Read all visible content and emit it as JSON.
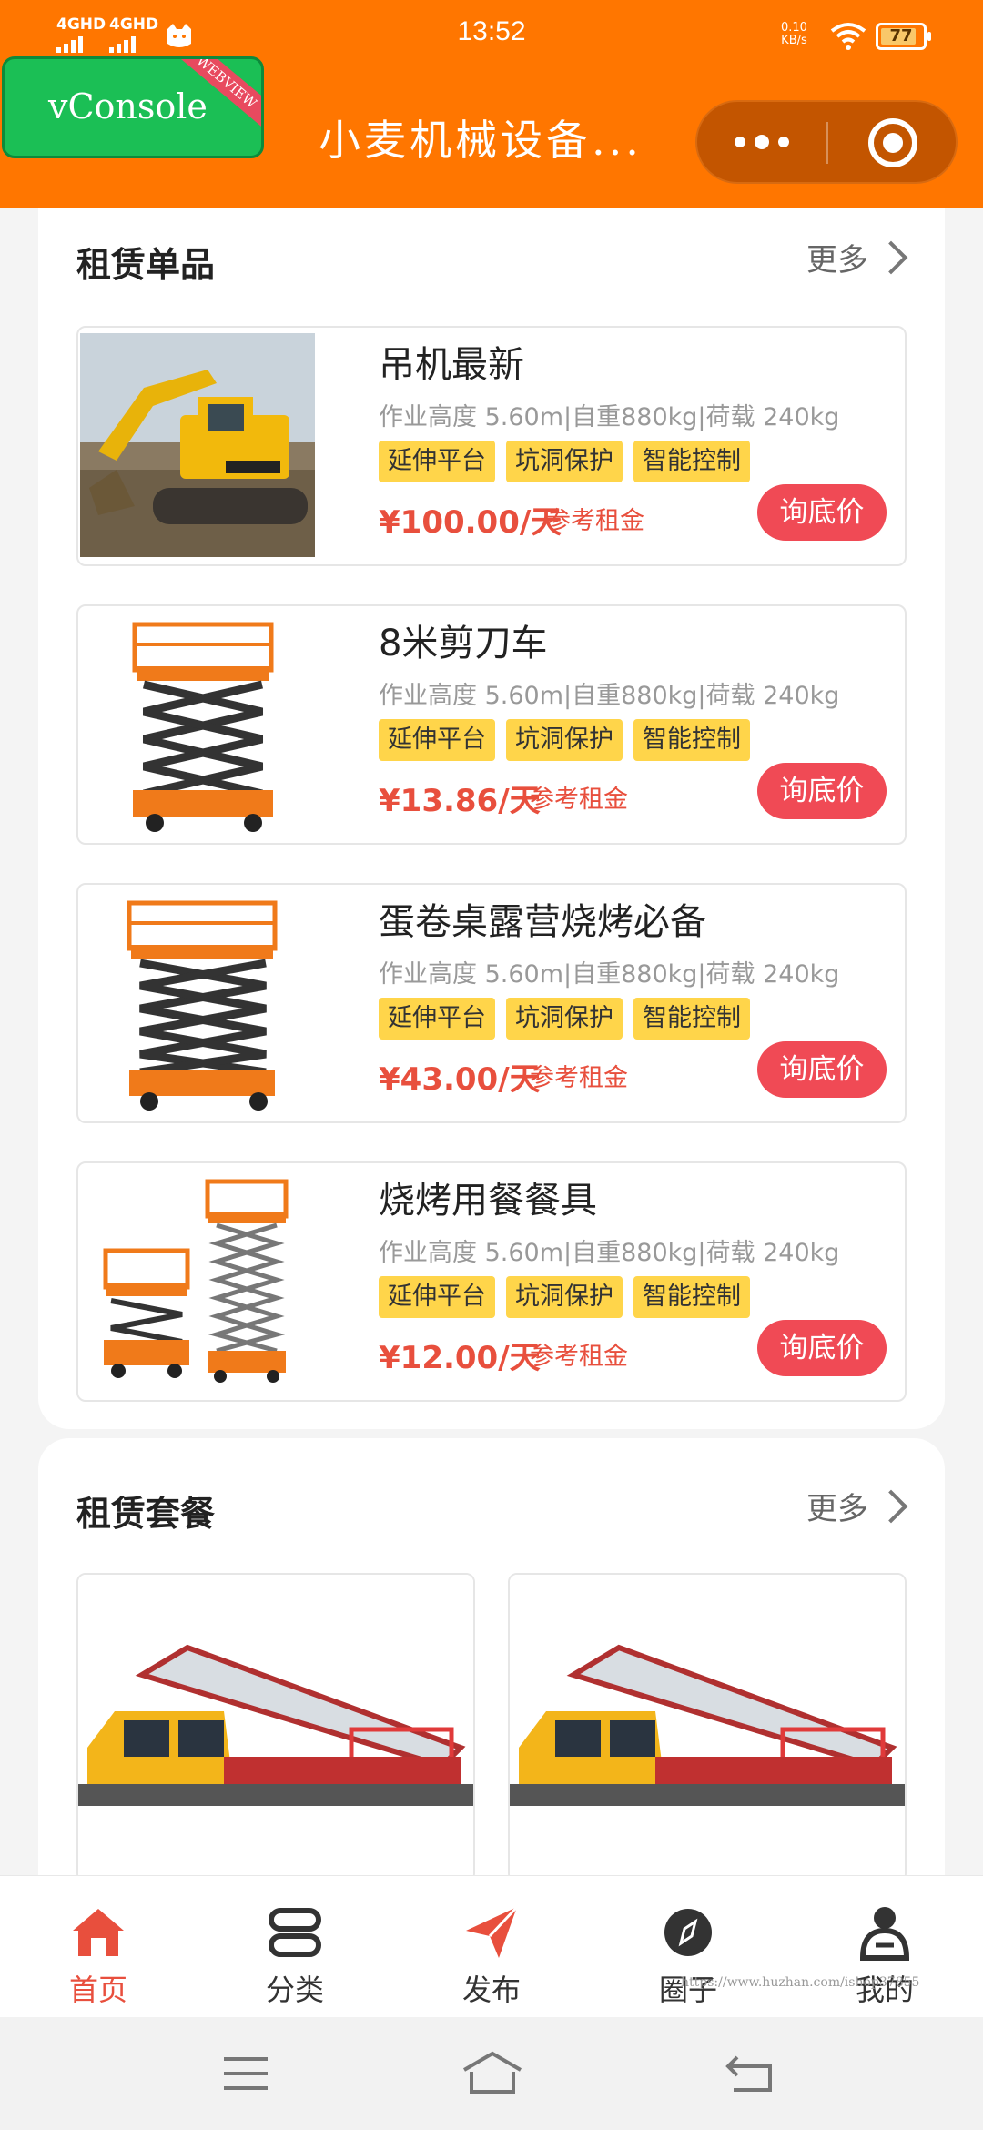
{
  "status": {
    "time": "13:52",
    "net1": "4GHD",
    "net2": "4GHD",
    "speed_value": "0.10",
    "speed_unit": "KB/s",
    "battery": "77"
  },
  "header": {
    "title": "小麦机械设备...",
    "vconsole_label": "vConsole",
    "vconsole_ribbon": "WEBVIEW"
  },
  "rental_items": {
    "title": "租赁单品",
    "more": "更多",
    "items": [
      {
        "name": "吊机最新",
        "spec": "作业高度 5.60m|自重880kg|荷载 240kg",
        "tags": [
          "延伸平台",
          "坑洞保护",
          "智能控制"
        ],
        "price": "¥100.00/天",
        "ref": "参考租金",
        "ask": "询底价"
      },
      {
        "name": "8米剪刀车",
        "spec": "作业高度 5.60m|自重880kg|荷载 240kg",
        "tags": [
          "延伸平台",
          "坑洞保护",
          "智能控制"
        ],
        "price": "¥13.86/天",
        "ref": "参考租金",
        "ask": "询底价"
      },
      {
        "name": "蛋卷桌露营烧烤必备",
        "spec": "作业高度 5.60m|自重880kg|荷载 240kg",
        "tags": [
          "延伸平台",
          "坑洞保护",
          "智能控制"
        ],
        "price": "¥43.00/天",
        "ref": "参考租金",
        "ask": "询底价"
      },
      {
        "name": "烧烤用餐餐具",
        "spec": "作业高度 5.60m|自重880kg|荷载 240kg",
        "tags": [
          "延伸平台",
          "坑洞保护",
          "智能控制"
        ],
        "price": "¥12.00/天",
        "ref": "参考租金",
        "ask": "询底价"
      }
    ]
  },
  "rental_packages": {
    "title": "租赁套餐",
    "more": "更多"
  },
  "tabbar": {
    "items": [
      {
        "label": "首页",
        "icon": "home-icon",
        "active": true
      },
      {
        "label": "分类",
        "icon": "category-icon",
        "active": false
      },
      {
        "label": "发布",
        "icon": "send-icon",
        "active": false
      },
      {
        "label": "圈子",
        "icon": "compass-icon",
        "active": false
      },
      {
        "label": "我的",
        "icon": "user-icon",
        "active": false
      }
    ]
  },
  "watermark": "https://www.huzhan.com/ishop37855",
  "colors": {
    "header": "#ff7600",
    "price": "#e84f3d",
    "tag": "#ffd54a",
    "ask_button": "#f04a55"
  }
}
